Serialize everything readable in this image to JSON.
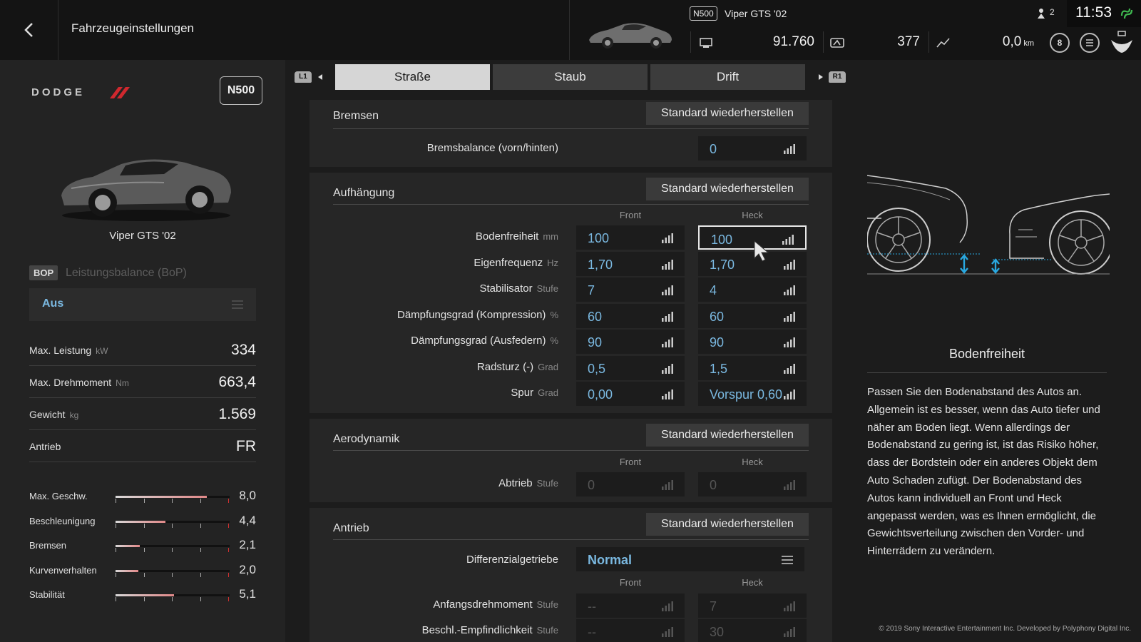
{
  "header": {
    "title": "Fahrzeugeinstellungen",
    "pp_badge": "N500",
    "car_name": "Viper GTS '02",
    "credits": "91.760",
    "mileage_points": "377",
    "odometer": "0,0",
    "odometer_unit": "km",
    "level": "8",
    "friends_online": "2",
    "clock": "11:53"
  },
  "left": {
    "brand": "DODGE",
    "pp_badge": "N500",
    "car_name": "Viper GTS '02",
    "bop_badge": "BOP",
    "bop_label": "Leistungsbalance (BoP)",
    "bop_value": "Aus",
    "specs": [
      {
        "label": "Max. Leistung",
        "unit": "kW",
        "value": "334"
      },
      {
        "label": "Max. Drehmoment",
        "unit": "Nm",
        "value": "663,4"
      },
      {
        "label": "Gewicht",
        "unit": "kg",
        "value": "1.569"
      },
      {
        "label": "Antrieb",
        "unit": "",
        "value": "FR"
      }
    ],
    "ratings": [
      {
        "label": "Max. Geschw.",
        "value": "8,0",
        "fill": 0.8
      },
      {
        "label": "Beschleunigung",
        "value": "4,4",
        "fill": 0.44
      },
      {
        "label": "Bremsen",
        "value": "2,1",
        "fill": 0.21
      },
      {
        "label": "Kurvenverhalten",
        "value": "2,0",
        "fill": 0.2
      },
      {
        "label": "Stabilität",
        "value": "5,1",
        "fill": 0.51
      }
    ]
  },
  "tabs": {
    "l1": "L1",
    "r1": "R1",
    "items": [
      {
        "label": "Straße",
        "active": true
      },
      {
        "label": "Staub",
        "active": false
      },
      {
        "label": "Drift",
        "active": false
      }
    ]
  },
  "reset_label": "Standard wiederherstellen",
  "col_front": "Front",
  "col_rear": "Heck",
  "brakes": {
    "title": "Bremsen",
    "balance_label": "Bremsbalance (vorn/hinten)",
    "balance_value": "0"
  },
  "suspension": {
    "title": "Aufhängung",
    "rows": [
      {
        "label": "Bodenfreiheit",
        "unit": "mm",
        "front": "100",
        "rear": "100"
      },
      {
        "label": "Eigenfrequenz",
        "unit": "Hz",
        "front": "1,70",
        "rear": "1,70"
      },
      {
        "label": "Stabilisator",
        "unit": "Stufe",
        "front": "7",
        "rear": "4"
      },
      {
        "label": "Dämpfungsgrad (Kompression)",
        "unit": "%",
        "front": "60",
        "rear": "60"
      },
      {
        "label": "Dämpfungsgrad (Ausfedern)",
        "unit": "%",
        "front": "90",
        "rear": "90"
      },
      {
        "label": "Radsturz (-)",
        "unit": "Grad",
        "front": "0,5",
        "rear": "1,5"
      },
      {
        "label": "Spur",
        "unit": "Grad",
        "front": "0,00",
        "rear": "Vorspur 0,60"
      }
    ]
  },
  "aero": {
    "title": "Aerodynamik",
    "label": "Abtrieb",
    "unit": "Stufe",
    "front": "0",
    "rear": "0"
  },
  "drivetrain": {
    "title": "Antrieb",
    "diff_label": "Differenzialgetriebe",
    "diff_value": "Normal",
    "rows": [
      {
        "label": "Anfangsdrehmoment",
        "unit": "Stufe",
        "front": "--",
        "rear": "7"
      },
      {
        "label": "Beschl.-Empfindlichkeit",
        "unit": "Stufe",
        "front": "--",
        "rear": "30"
      }
    ]
  },
  "help": {
    "title": "Bodenfreiheit",
    "text": "Passen Sie den Bodenabstand des Autos an. Allgemein ist es besser, wenn das Auto tiefer und näher am Boden liegt. Wenn allerdings der Bodenabstand zu gering ist, ist das Risiko höher, dass der Bordstein oder ein anderes Objekt dem Auto Schaden zufügt. Der Bodenabstand des Autos kann individuell an Front und Heck angepasst werden, was es Ihnen ermöglicht, die Gewichtsverteilung zwischen den Vorder- und Hinterrädern zu verändern."
  },
  "copyright": "© 2019 Sony Interactive Entertainment Inc. Developed by Polyphony Digital Inc.",
  "colors": {
    "accent": "#7ab8e0",
    "arrow": "#29a8e0"
  }
}
